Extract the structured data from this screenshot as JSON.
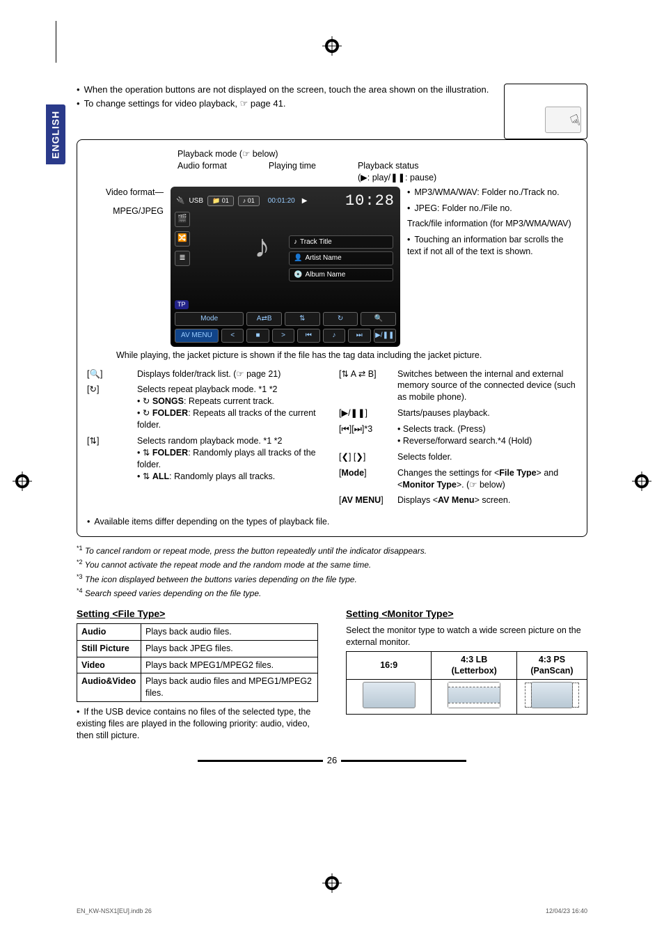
{
  "language_tab": "ENGLISH",
  "intro_bullets": [
    "When the operation buttons are not displayed on the screen, touch the area shown on the illustration.",
    "To change settings for video playback, ☞ page 41."
  ],
  "touch_hand_glyph": "☟",
  "overview": {
    "top_labels": {
      "playback_mode": "Playback mode (☞ below)",
      "audio_format": "Audio format",
      "playing_time": "Playing time",
      "playback_status_title": "Playback status",
      "playback_status_detail": "(▶: play/❚❚: pause)"
    },
    "left_callouts": {
      "video_format": "Video format",
      "mpeg_jpeg": "MPEG/JPEG"
    },
    "player": {
      "usb": "USB",
      "folder_no": "01",
      "track_no": "01",
      "elapsed": "00:01:20",
      "clock": "10:28",
      "track_title": "Track Title",
      "artist_name": "Artist Name",
      "album_name": "Album Name",
      "tp": "TP",
      "mode": "Mode",
      "ab": "A⇄B",
      "shuffle": "⇅",
      "repeat": "↻",
      "av_menu": "AV MENU",
      "row3": [
        "<",
        "■",
        ">",
        "⏮",
        "♪",
        "⏭",
        "▶/❚❚"
      ]
    },
    "right_callouts": [
      "MP3/WMA/WAV: Folder no./Track no.",
      "JPEG: Folder no./File no.",
      "Track/file information (for MP3/WMA/WAV)",
      "Touching an information bar scrolls the text if not all of the text is shown."
    ],
    "jacket_note": "While playing, the jacket picture is shown if the file has the tag data including the jacket picture."
  },
  "controls_left": [
    {
      "label": "[🔍]",
      "desc": "Displays folder/track list. (☞ page 21)"
    },
    {
      "label": "[↻]",
      "desc": "Selects repeat playback mode. *1 *2",
      "subs": [
        {
          "icon": "↻",
          "bold": "SONGS",
          "rest": ": Repeats current track."
        },
        {
          "icon": "↻",
          "bold": "FOLDER",
          "rest": ": Repeats all tracks of the current folder."
        }
      ]
    },
    {
      "label": "[⇅]",
      "desc": "Selects random playback mode. *1 *2",
      "subs": [
        {
          "icon": "⇅",
          "bold": "FOLDER",
          "rest": ": Randomly plays all tracks of the folder."
        },
        {
          "icon": "⇅",
          "bold": "ALL",
          "rest": ": Randomly plays all tracks."
        }
      ]
    }
  ],
  "controls_right": [
    {
      "label": "[⇅ A ⇄ B]",
      "desc": "Switches between the internal and external memory source of the connected device (such as mobile phone)."
    },
    {
      "label": "[▶/❚❚]",
      "desc": "Starts/pauses playback."
    },
    {
      "label": "[⏮][⏭]*3",
      "subs": [
        {
          "rest": "Selects track. (Press)"
        },
        {
          "rest": "Reverse/forward search.*4 (Hold)"
        }
      ]
    },
    {
      "label": "[❮] [❯]",
      "desc": "Selects folder."
    },
    {
      "label_plain": "[Mode]",
      "desc_html": "Changes the settings for <<b>File Type</b>> and <<b>Monitor Type</b>>. (☞ below)"
    },
    {
      "label_plain": "[AV MENU]",
      "desc_html": "Displays <<b>AV Menu</b>> screen."
    }
  ],
  "available_note": "Available items differ depending on the types of playback file.",
  "footnotes": [
    {
      "sup": "*1",
      "text": "To cancel random or repeat mode, press the button repeatedly until the indicator disappears."
    },
    {
      "sup": "*2",
      "text": "You cannot activate the repeat mode and the random mode at the same time."
    },
    {
      "sup": "*3",
      "text": "The icon displayed between the buttons varies depending on the file type."
    },
    {
      "sup": "*4",
      "text": "Search speed varies depending on the file type."
    }
  ],
  "file_type": {
    "heading": "Setting <File Type>",
    "rows": [
      [
        "Audio",
        "Plays back audio files."
      ],
      [
        "Still Picture",
        "Plays back JPEG files."
      ],
      [
        "Video",
        "Plays back MPEG1/MPEG2 files."
      ],
      [
        "Audio&Video",
        "Plays back audio files and MPEG1/MPEG2 files."
      ]
    ],
    "note": "If the USB device contains no files of the selected type, the existing files are played in the following priority: audio, video, then still picture."
  },
  "monitor_type": {
    "heading": "Setting <Monitor Type>",
    "intro": "Select the monitor type to watch a wide screen picture on the external monitor.",
    "headers": [
      "16:9",
      "4:3 LB",
      "4:3 PS"
    ],
    "subs": [
      "",
      "(Letterbox)",
      "(PanScan)"
    ]
  },
  "page_number": "26",
  "footer_left": "EN_KW-NSX1[EU].indb   26",
  "footer_right": "12/04/23   16:40"
}
